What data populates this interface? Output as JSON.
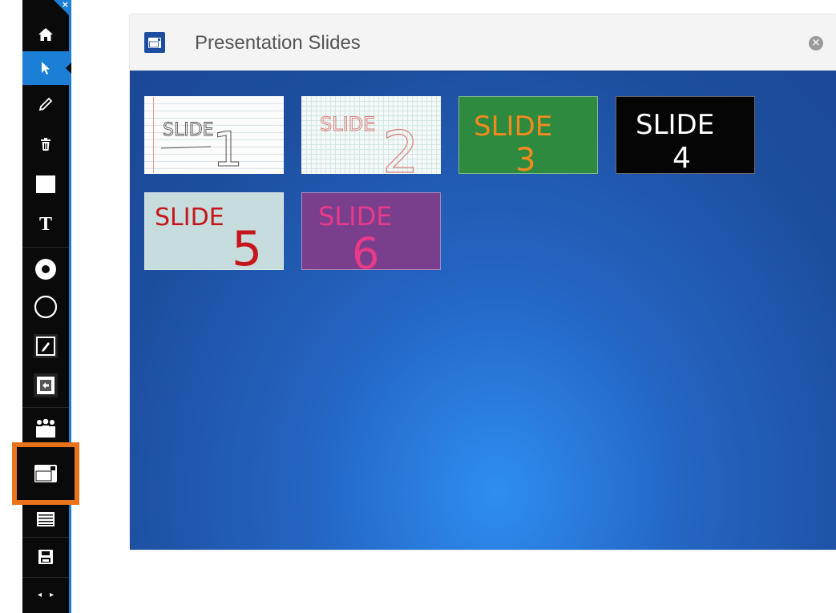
{
  "panel": {
    "title": "Presentation Slides"
  },
  "toolbar": {
    "close_glyph": "×",
    "prev_glyph": "◂",
    "next_glyph": "▸",
    "items": [
      {
        "icon": "home-icon"
      },
      {
        "icon": "pointer-icon",
        "active": true
      },
      {
        "icon": "pen-icon"
      },
      {
        "icon": "trash-icon"
      },
      {
        "icon": "rectangle-icon"
      },
      {
        "icon": "text-icon",
        "label": "T"
      },
      {
        "icon": "line-weight-icon"
      },
      {
        "icon": "circle-icon"
      },
      {
        "icon": "pen-color-icon"
      },
      {
        "icon": "fill-icon"
      },
      {
        "icon": "participants-icon"
      },
      {
        "icon": "slides-icon",
        "highlighted": true
      },
      {
        "icon": "list-icon"
      },
      {
        "icon": "save-icon"
      }
    ],
    "highlight_color": "#e8731a",
    "accent_color": "#1b7fd6"
  },
  "slides": [
    {
      "word": "SLIDE",
      "number": "1",
      "background": "#fbfbfb",
      "ink": "#444444"
    },
    {
      "word": "SLIDE",
      "number": "2",
      "background": "#f4f8f8",
      "ink": "#d9807a"
    },
    {
      "word": "SLIDE",
      "number": "3",
      "background": "#2e8a3e",
      "ink": "#f28a1e"
    },
    {
      "word": "SLIDE",
      "number": "4",
      "background": "#050505",
      "ink": "#ffffff"
    },
    {
      "word": "SLIDE",
      "number": "5",
      "background": "#c7dcdc",
      "ink": "#c4161c"
    },
    {
      "word": "SLIDE",
      "number": "6",
      "background": "#7a3f8c",
      "ink": "#e8398a"
    }
  ]
}
